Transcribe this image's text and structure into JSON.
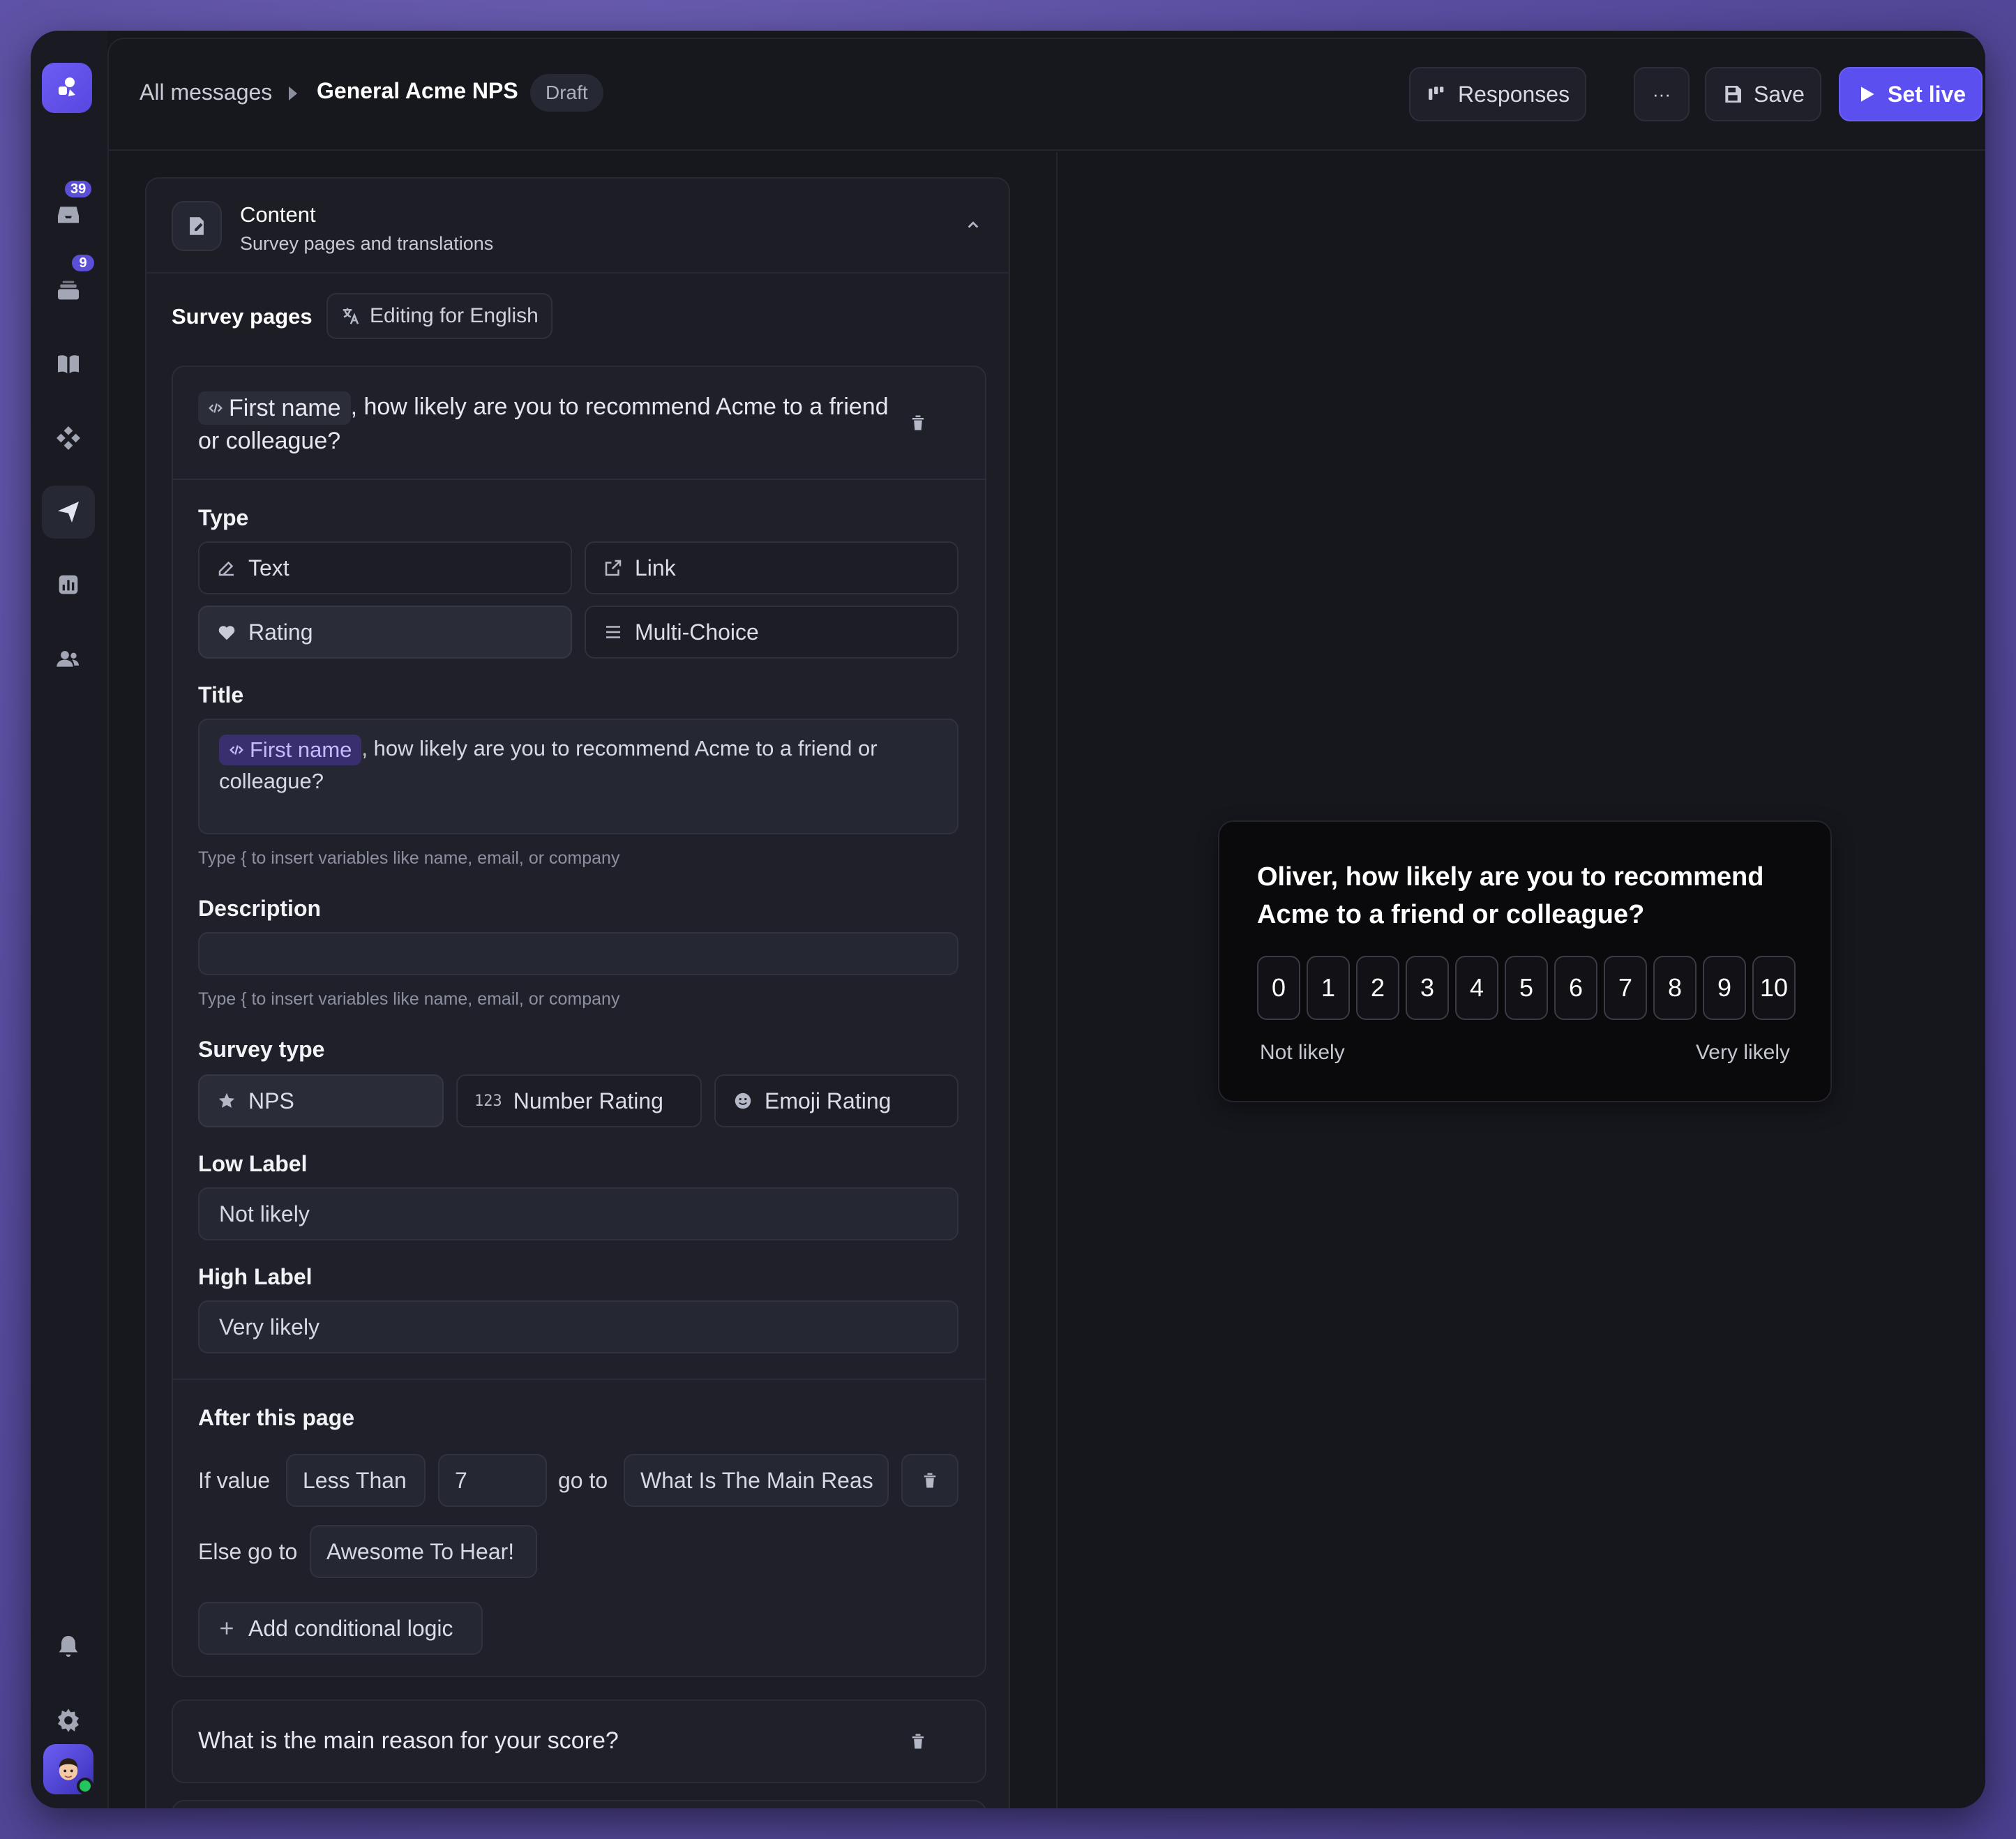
{
  "sidebar": {
    "inbox_badge": "39",
    "tickets_badge": "9",
    "icons": [
      "logo-icon",
      "inbox-icon",
      "tickets-icon",
      "book-icon",
      "integrations-icon",
      "messages-icon",
      "reports-icon",
      "contacts-icon",
      "bell-icon",
      "gear-icon",
      "avatar"
    ]
  },
  "header": {
    "breadcrumb_root": "All messages",
    "title": "General Acme NPS",
    "status": "Draft",
    "responses_label": "Responses",
    "more_label": "···",
    "save_label": "Save",
    "set_live_label": "Set live"
  },
  "content_section": {
    "title": "Content",
    "subtitle": "Survey pages and translations"
  },
  "survey_pages": {
    "label": "Survey pages",
    "language_label": "Editing for English"
  },
  "page1": {
    "variable_chip": "First name",
    "question_rest": ", how likely are you to recommend Acme to a friend or colleague?",
    "type_label": "Type",
    "types": [
      "Text",
      "Link",
      "Rating",
      "Multi-Choice"
    ],
    "selected_type": "Rating",
    "title_label": "Title",
    "title_chip": "First name",
    "title_rest": ", how likely are you to recommend Acme to a friend or colleague?",
    "title_hint": "Type { to insert variables like name, email, or company",
    "description_label": "Description",
    "description_value": "",
    "description_hint": "Type { to insert variables like name, email, or company",
    "survey_type_label": "Survey type",
    "survey_types": [
      "NPS",
      "Number Rating",
      "Emoji Rating"
    ],
    "number_rating_icon_text": "123",
    "selected_survey_type": "NPS",
    "low_label_label": "Low Label",
    "low_label_value": "Not likely",
    "high_label_label": "High Label",
    "high_label_value": "Very likely",
    "after_label": "After this page",
    "rule_if": "If value",
    "rule_operator": "Less Than",
    "rule_value": "7",
    "rule_goto": "go to",
    "rule_target": "What Is The Main Reas",
    "else_label": "Else go to",
    "else_target": "Awesome To Hear!",
    "add_logic_label": "Add conditional logic"
  },
  "page2": {
    "question": "What is the main reason for your score?"
  },
  "preview": {
    "question": "Oliver, how likely are you to recommend Acme to a friend or colleague?",
    "scale": [
      "0",
      "1",
      "2",
      "3",
      "4",
      "5",
      "6",
      "7",
      "8",
      "9",
      "10"
    ],
    "low": "Not likely",
    "high": "Very likely"
  },
  "colors": {
    "accent": "#5b4ff0",
    "background": "#17181e",
    "online": "#22c55e"
  }
}
